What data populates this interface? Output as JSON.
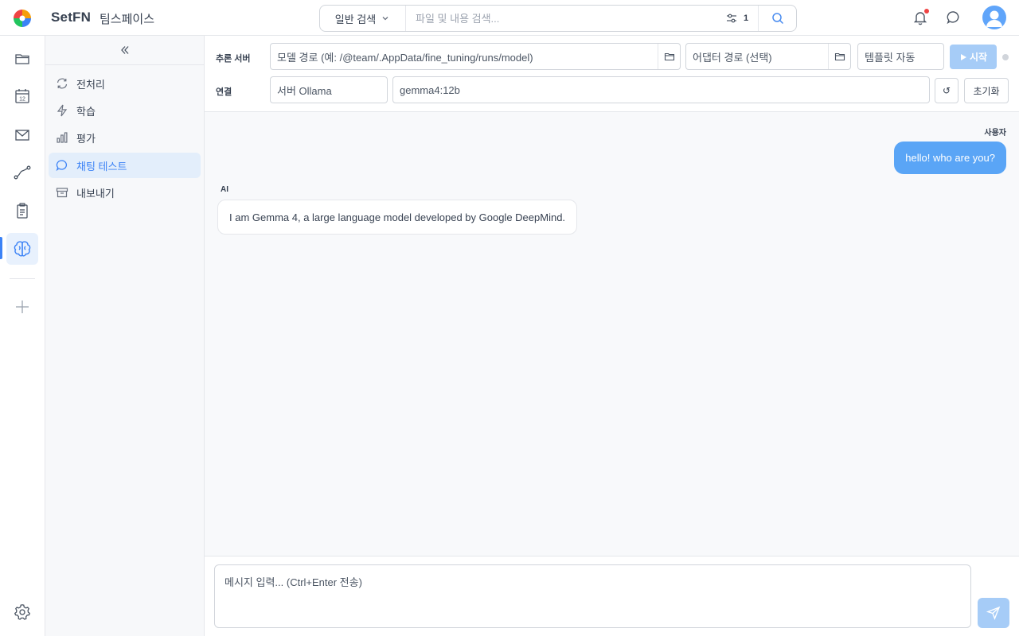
{
  "header": {
    "brand": "SetFN",
    "workspace": "팀스페이스",
    "search_type": "일반 검색",
    "search_placeholder": "파일 및 내용 검색...",
    "filter_count": "1",
    "icons": [
      "app-logo",
      "chevron-down-icon",
      "sliders-icon",
      "search-icon",
      "bell-icon",
      "chat-bubble-icon",
      "user-avatar-icon"
    ],
    "notification_dot_color": "#ef4444"
  },
  "rail": {
    "items": [
      {
        "name": "folder-icon"
      },
      {
        "name": "calendar-icon",
        "label": "12"
      },
      {
        "name": "mail-icon"
      },
      {
        "name": "route-icon"
      },
      {
        "name": "clipboard-icon"
      },
      {
        "name": "brain-icon",
        "active": true
      },
      {
        "name": "plus-icon"
      },
      {
        "name": "settings-icon"
      }
    ],
    "accent": "#3b82f6"
  },
  "subnav": {
    "items": [
      {
        "label": "전처리",
        "icon": "refresh-icon"
      },
      {
        "label": "학습",
        "icon": "lightning-icon"
      },
      {
        "label": "평가",
        "icon": "bar-chart-icon"
      },
      {
        "label": "채팅 테스트",
        "icon": "chat-bubble-icon",
        "active": true
      },
      {
        "label": "내보내기",
        "icon": "archive-icon"
      }
    ]
  },
  "toolbar": {
    "inference_label": "추론 서버",
    "model_path_placeholder": "모델 경로 (예: /@team/.AppData/fine_tuning/runs/model)",
    "adapter_path_placeholder": "어댑터 경로 (선택)",
    "template": "템플릿 자동",
    "start_label": "시작",
    "connection_label": "연결",
    "server": "서버 Ollama",
    "model": "gemma4:12b",
    "refresh_glyph": "↺",
    "reset_label": "초기화"
  },
  "chat": {
    "user_label": "사용자",
    "user_message": "hello! who are you?",
    "ai_label": "AI",
    "ai_message": "I am Gemma 4, a large language model developed by Google DeepMind."
  },
  "composer": {
    "placeholder": "메시지 입력... (Ctrl+Enter 전송)"
  }
}
